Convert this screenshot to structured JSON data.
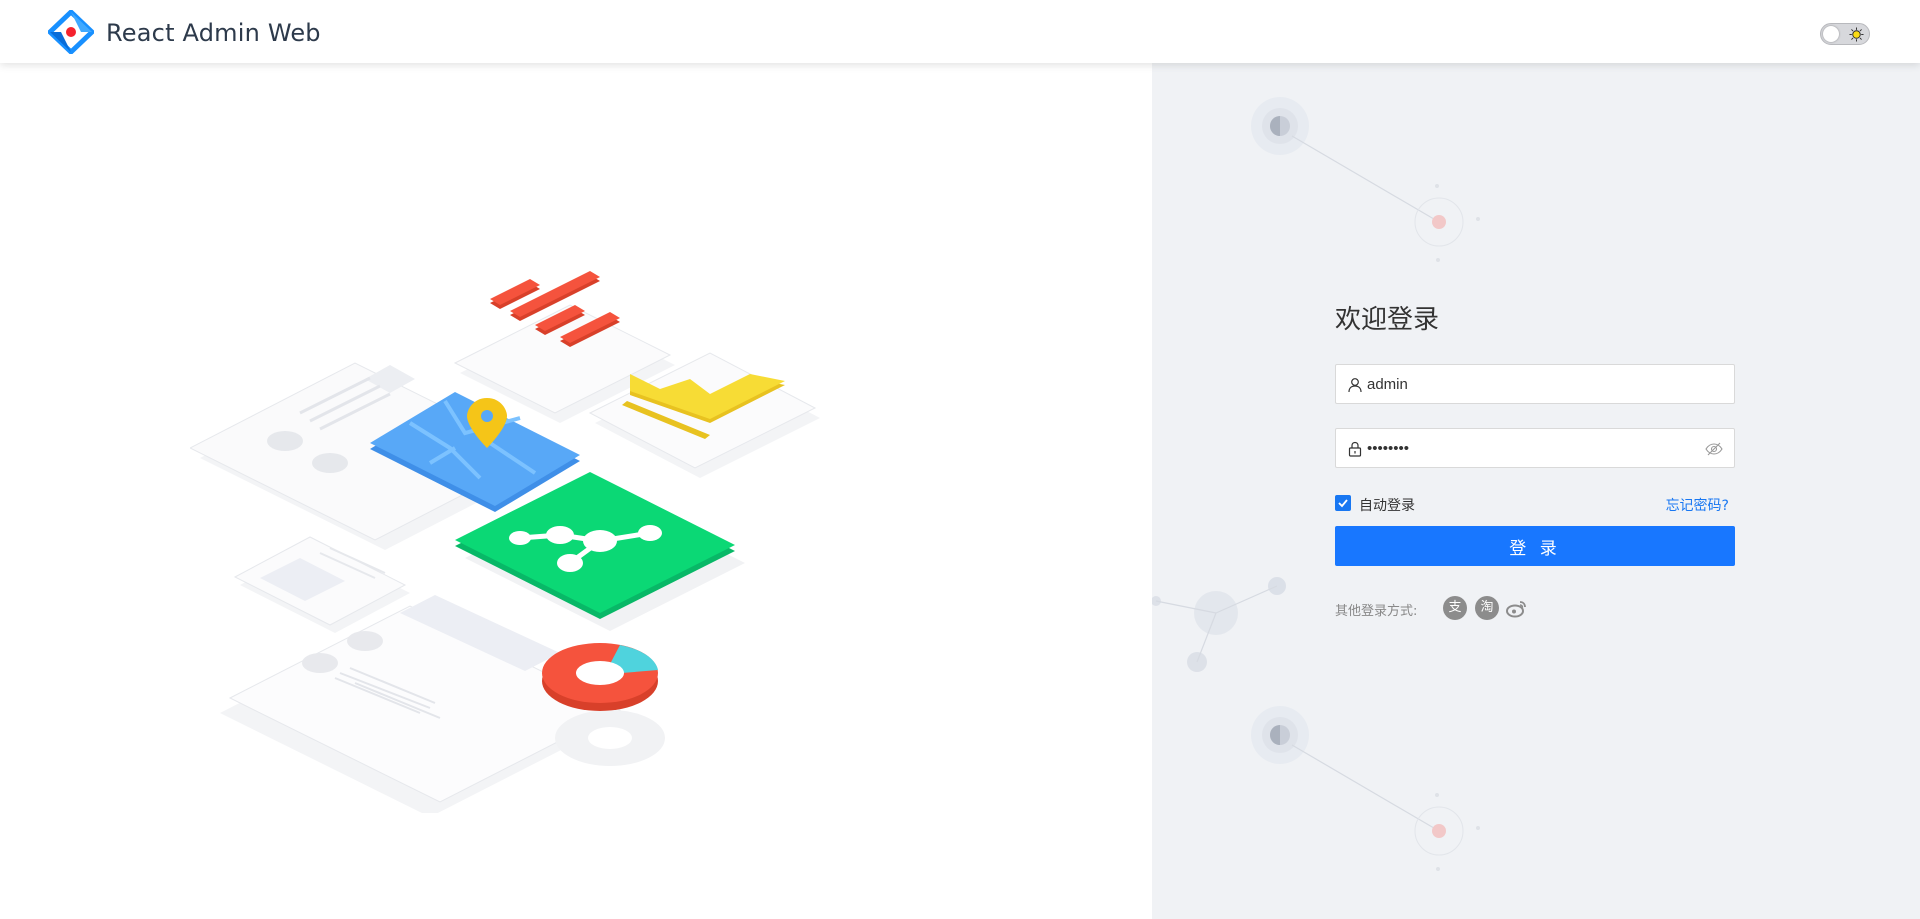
{
  "header": {
    "app_title": "React Admin Web",
    "logo_icon": "react-admin-logo",
    "theme_toggle": {
      "state": "off",
      "icon": "sun-icon"
    }
  },
  "login": {
    "welcome": "欢迎登录",
    "username": {
      "value": "admin",
      "icon": "user-icon"
    },
    "password": {
      "value": "••••••••",
      "icon": "lock-icon",
      "toggle_icon": "eye-invisible-icon"
    },
    "remember": {
      "label": "自动登录",
      "checked": true
    },
    "forgot": "忘记密码?",
    "submit": "登 录",
    "other_label": "其他登录方式:",
    "social": [
      {
        "name": "alipay",
        "glyph": "支"
      },
      {
        "name": "taobao",
        "glyph": "淘"
      },
      {
        "name": "weibo",
        "glyph": ""
      }
    ]
  },
  "colors": {
    "primary": "#1877ff",
    "right_panel_bg": "#f0f2f5",
    "title_text": "#2d3a4b"
  }
}
